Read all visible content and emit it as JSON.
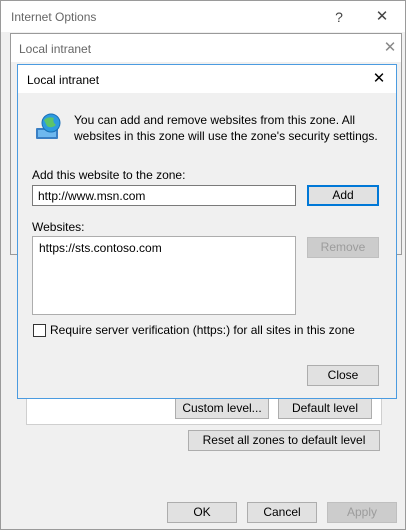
{
  "outer": {
    "title": "Internet Options",
    "help_glyph": "?",
    "close_glyph": "✕",
    "ok_label": "OK",
    "cancel_label": "Cancel",
    "apply_label": "Apply",
    "custom_level_label": "Custom level...",
    "default_level_label": "Default level",
    "reset_zones_label": "Reset all zones to default level"
  },
  "intranet_behind": {
    "title": "Local intranet",
    "close_glyph": "✕"
  },
  "dialog": {
    "title": "Local intranet",
    "close_glyph": "✕",
    "info_text": "You can add and remove websites from this zone. All websites in this zone will use the zone's security settings.",
    "add_label": "Add this website to the zone:",
    "add_value": "http://www.msn.com",
    "add_button": "Add",
    "websites_label": "Websites:",
    "websites": [
      "https://sts.contoso.com"
    ],
    "remove_button": "Remove",
    "require_verification_label": "Require server verification (https:) for all sites in this zone",
    "require_verification_checked": false,
    "close_button": "Close"
  },
  "icons": {
    "globe": "globe-icon"
  },
  "colors": {
    "focus_border": "#0078d7",
    "dialog_bg": "#f0f0f0",
    "disabled_text": "#9c9c9c"
  }
}
